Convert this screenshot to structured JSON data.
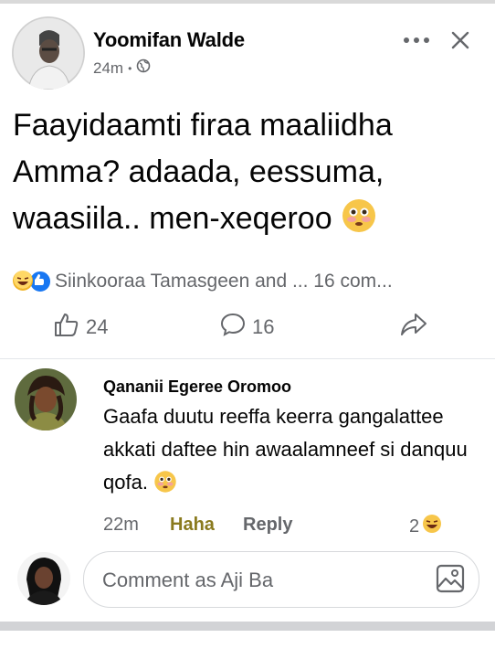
{
  "post": {
    "author": "Yoomifan Walde",
    "time": "24m",
    "visibility_icon": "globe-icon",
    "text": "Faayidaamti firaa maaliidha Amma? adaada, eessuma, waasiila.. men-xeqeroo",
    "text_emoji": "flushed-emoji",
    "reaction_summary": "Siinkooraa Tamasgeen and ... 16 com...",
    "reaction_icons": [
      "haha-reaction-icon",
      "like-reaction-icon"
    ],
    "like_count": "24",
    "comment_count": "16"
  },
  "comment": {
    "author": "Qananii Egeree Oromoo",
    "text": "Gaafa duutu reeffa keerra gangalattee akkati daftee hin awaalamneef si danquu qofa.",
    "time": "22m",
    "haha_label": "Haha",
    "reply_label": "Reply",
    "reaction_count": "2"
  },
  "composer": {
    "placeholder": "Comment as Aji Ba"
  },
  "colors": {
    "text": "#050505",
    "secondary": "#65676b",
    "haha": "#8a7a1e",
    "like_blue": "#1877f2"
  }
}
